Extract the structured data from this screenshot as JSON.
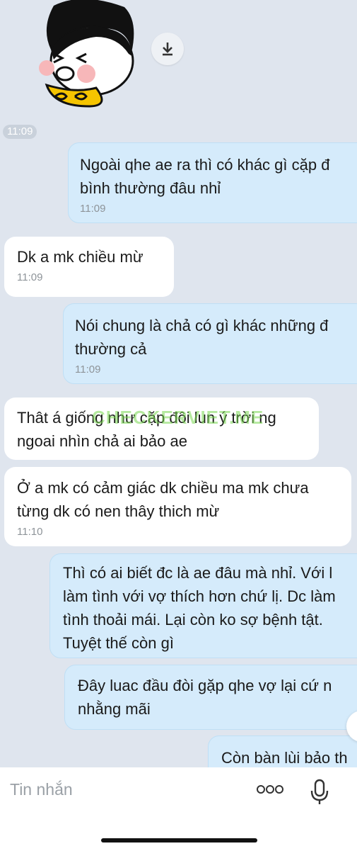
{
  "sticker": {
    "icon": "girl-sticker"
  },
  "download": {
    "icon": "download-icon"
  },
  "time_pill": "11:09",
  "messages": [
    {
      "dir": "out",
      "lines": [
        "Ngoài qhe ae ra thì có khác gì cặp đ",
        "bình thường đâu nhỉ"
      ],
      "time": "11:09"
    },
    {
      "dir": "in",
      "lines": [
        "Dk a mk chiều mừ"
      ],
      "time": "11:09"
    },
    {
      "dir": "out",
      "lines": [
        "Nói chung là chả có gì khác những đ",
        "thường cả"
      ],
      "time": "11:09"
    },
    {
      "dir": "in",
      "lines": [
        "Thât á giống như cặp đôi lun ý trời ng",
        "ngoai nhìn chả ai bảo ae"
      ],
      "time": ""
    },
    {
      "dir": "in",
      "lines": [
        "Ở a mk có cảm giác dk chiều ma mk chưa",
        "từng dk có nen thây thich mừ"
      ],
      "time": "11:10"
    },
    {
      "dir": "out",
      "lines": [
        "Thì có ai biết đc là ae đâu mà nhỉ. Với l",
        "làm tình với vợ thích hơn chứ lị. Dc làm",
        "tình thoải mái. Lại còn ko sợ bệnh tật.",
        "Tuyệt thế còn gì"
      ],
      "time": ""
    },
    {
      "dir": "out",
      "lines": [
        "Đây luac đầu đòi gặp qhe vợ lại cứ n",
        "nhằng mãi"
      ],
      "time": ""
    },
    {
      "dir": "out",
      "lines": [
        "Còn bàn lùi bảo th"
      ],
      "time": ""
    }
  ],
  "watermark": "CHECKERVIET.ME",
  "composer": {
    "placeholder": "Tin nhắn",
    "more_icon": "more-dots-icon",
    "mic_icon": "microphone-icon"
  },
  "colors": {
    "background": "#dfe5ee",
    "outgoing_bubble": "#d5ebfb",
    "incoming_bubble": "#ffffff"
  }
}
